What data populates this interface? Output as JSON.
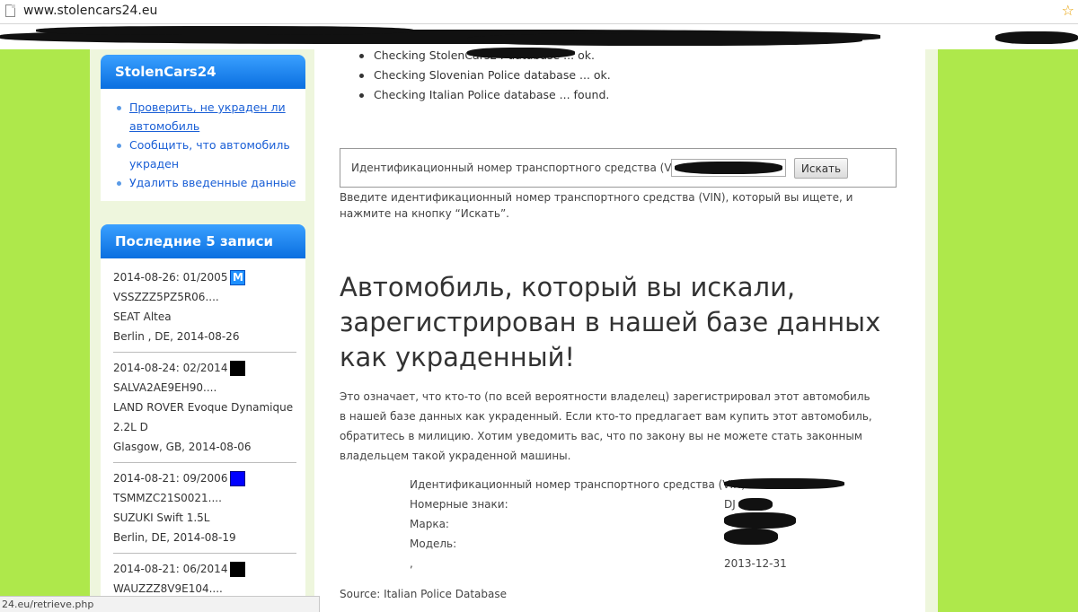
{
  "browser": {
    "url": "www.stolencars24.eu",
    "status_url": "24.eu/retrieve.php"
  },
  "sidebar": {
    "title": "StolenCars24",
    "links": [
      "Проверить, не украден ли автомобиль",
      "Сообщить, что автомобиль украден",
      "Удалить введенные данные"
    ],
    "recent_title": "Последние 5 записи",
    "recent": [
      {
        "date_line": "2014-08-26: 01/2005",
        "vin": "VSSZZZ5PZ5R06....",
        "model": "SEAT Altea",
        "place": "Berlin , DE, 2014-08-26",
        "badge_text": "M",
        "badge_color": "#1e90ff"
      },
      {
        "date_line": "2014-08-24: 02/2014",
        "vin": "SALVA2AE9EH90....",
        "model": "LAND ROVER Evoque Dynamique 2.2L D",
        "place": "Glasgow, GB, 2014-08-06",
        "badge_text": "",
        "badge_color": "#000000"
      },
      {
        "date_line": "2014-08-21: 09/2006",
        "vin": "TSMMZC21S0021....",
        "model": "SUZUKI Swift 1.5L",
        "place": "Berlin, DE, 2014-08-19",
        "badge_text": "",
        "badge_color": "#0000ff"
      },
      {
        "date_line": "2014-08-21: 06/2014",
        "vin": "WAUZZZ8V9E104....",
        "model": "",
        "place": "",
        "badge_text": "",
        "badge_color": "#000000"
      }
    ]
  },
  "checks": [
    "Checking StolenCars24 database ... ok.",
    "Checking Slovenian Police database ... ok.",
    "Checking Italian Police database ... found."
  ],
  "search": {
    "label": "Идентификационный номер транспортного средства (VIN):",
    "button": "Искать",
    "hint": "Введите идентификационный номер транспортного средства (VIN), который вы ищете, и нажмите на кнопку “Искать”."
  },
  "result": {
    "title": "Автомобиль, который вы искали, зарегистрирован в нашей базе данных как украденный!",
    "description": "Это означает, что кто-то (по всей вероятности владелец) зарегистрировал этот автомобиль в нашей базе данных как украденный. Если кто-то предлагает вам купить этот автомобиль, обратитесь в милицию. Хотим уведомить вас, что по закону вы не можете стать законным владельцем такой украденной машины.",
    "details": [
      {
        "label": "Идентификационный номер транспортного средства (VIN):",
        "value": ""
      },
      {
        "label": "Номерные знаки:",
        "value": "DJ"
      },
      {
        "label": "Марка:",
        "value": ""
      },
      {
        "label": "Модель:",
        "value": ""
      },
      {
        "label": ",",
        "value": "2013-12-31"
      }
    ],
    "source": "Source: Italian Police Database"
  }
}
